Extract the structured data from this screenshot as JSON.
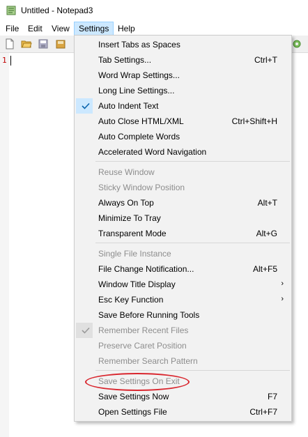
{
  "window": {
    "title": "Untitled - Notepad3"
  },
  "menubar": {
    "items": [
      {
        "label": "File"
      },
      {
        "label": "Edit"
      },
      {
        "label": "View"
      },
      {
        "label": "Settings"
      },
      {
        "label": "Help"
      }
    ]
  },
  "editor": {
    "line_number": "1"
  },
  "settings_menu": {
    "items": [
      {
        "label": "Insert Tabs as Spaces",
        "shortcut": "",
        "enabled": true,
        "checked": false
      },
      {
        "label": "Tab Settings...",
        "shortcut": "Ctrl+T",
        "enabled": true,
        "checked": false
      },
      {
        "label": "Word Wrap Settings...",
        "shortcut": "",
        "enabled": true,
        "checked": false
      },
      {
        "label": "Long Line Settings...",
        "shortcut": "",
        "enabled": true,
        "checked": false
      },
      {
        "label": "Auto Indent Text",
        "shortcut": "",
        "enabled": true,
        "checked": true
      },
      {
        "label": "Auto Close HTML/XML",
        "shortcut": "Ctrl+Shift+H",
        "enabled": true,
        "checked": false
      },
      {
        "label": "Auto Complete Words",
        "shortcut": "",
        "enabled": true,
        "checked": false
      },
      {
        "label": "Accelerated Word Navigation",
        "shortcut": "",
        "enabled": true,
        "checked": false
      },
      {
        "label": "Reuse Window",
        "shortcut": "",
        "enabled": false,
        "checked": false
      },
      {
        "label": "Sticky Window Position",
        "shortcut": "",
        "enabled": false,
        "checked": false
      },
      {
        "label": "Always On Top",
        "shortcut": "Alt+T",
        "enabled": true,
        "checked": false
      },
      {
        "label": "Minimize To Tray",
        "shortcut": "",
        "enabled": true,
        "checked": false
      },
      {
        "label": "Transparent Mode",
        "shortcut": "Alt+G",
        "enabled": true,
        "checked": false
      },
      {
        "label": "Single File Instance",
        "shortcut": "",
        "enabled": false,
        "checked": false
      },
      {
        "label": "File Change Notification...",
        "shortcut": "Alt+F5",
        "enabled": true,
        "checked": false
      },
      {
        "label": "Window Title Display",
        "shortcut": "",
        "enabled": true,
        "checked": false,
        "submenu": true
      },
      {
        "label": "Esc Key Function",
        "shortcut": "",
        "enabled": true,
        "checked": false,
        "submenu": true
      },
      {
        "label": "Save Before Running Tools",
        "shortcut": "",
        "enabled": true,
        "checked": false
      },
      {
        "label": "Remember Recent Files",
        "shortcut": "",
        "enabled": false,
        "checked": true
      },
      {
        "label": "Preserve Caret Position",
        "shortcut": "",
        "enabled": false,
        "checked": false
      },
      {
        "label": "Remember Search Pattern",
        "shortcut": "",
        "enabled": false,
        "checked": false
      },
      {
        "label": "Save Settings On Exit",
        "shortcut": "",
        "enabled": false,
        "checked": false
      },
      {
        "label": "Save Settings Now",
        "shortcut": "F7",
        "enabled": true,
        "checked": false
      },
      {
        "label": "Open Settings File",
        "shortcut": "Ctrl+F7",
        "enabled": true,
        "checked": false
      }
    ]
  },
  "annotation": {
    "color": "#d9262e"
  },
  "colors": {
    "accent_highlight": "#cce8ff",
    "line_number": "#c00000"
  }
}
